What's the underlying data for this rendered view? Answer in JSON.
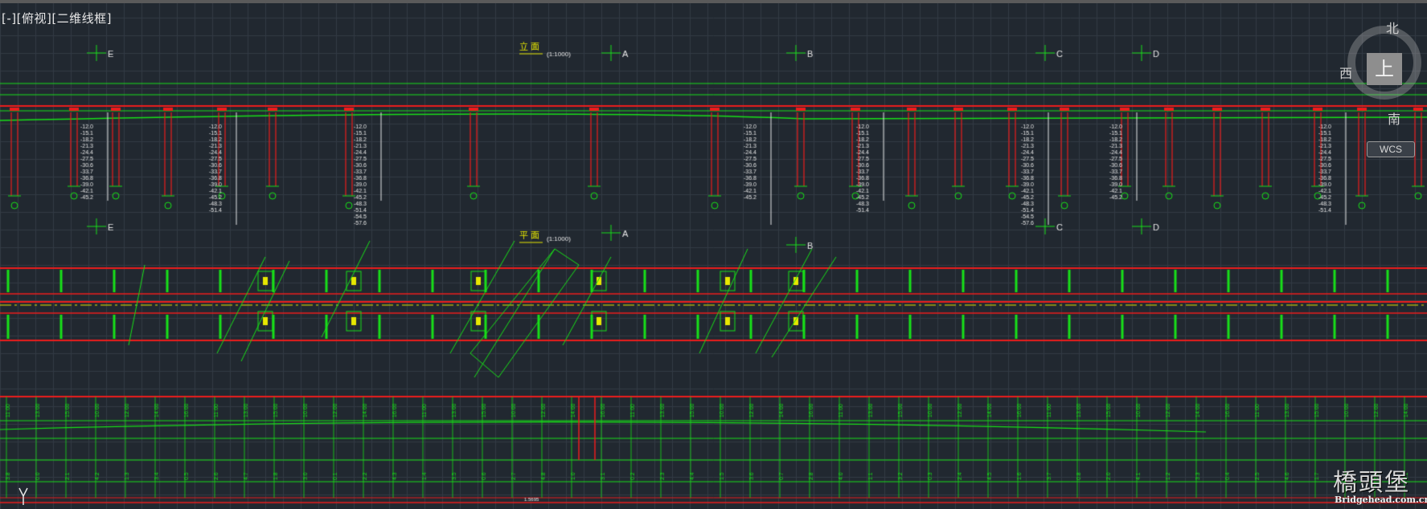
{
  "viewport": {
    "label": "[-][俯视][二维线框]"
  },
  "viewcube": {
    "face": "上",
    "north": "北",
    "west": "西",
    "south": "南"
  },
  "wcs": {
    "label": "WCS"
  },
  "watermark": {
    "brand": "橋頭堡",
    "url": "Bridgehead.com.cn"
  },
  "drawing": {
    "elevation_title": "立 面",
    "plan_title": "平 面",
    "scale": "(1:1000)",
    "axis_markers": [
      "E",
      "A",
      "B",
      "C",
      "D"
    ],
    "bottom_note": "1.5695"
  },
  "colors": {
    "background": "#212830",
    "grid": "#333b44",
    "line_green": "#18e018",
    "line_red": "#ee1c1c",
    "line_yellow": "#e8e800",
    "text_white": "#e6e6e6",
    "text_cyan": "#20d0d0"
  }
}
